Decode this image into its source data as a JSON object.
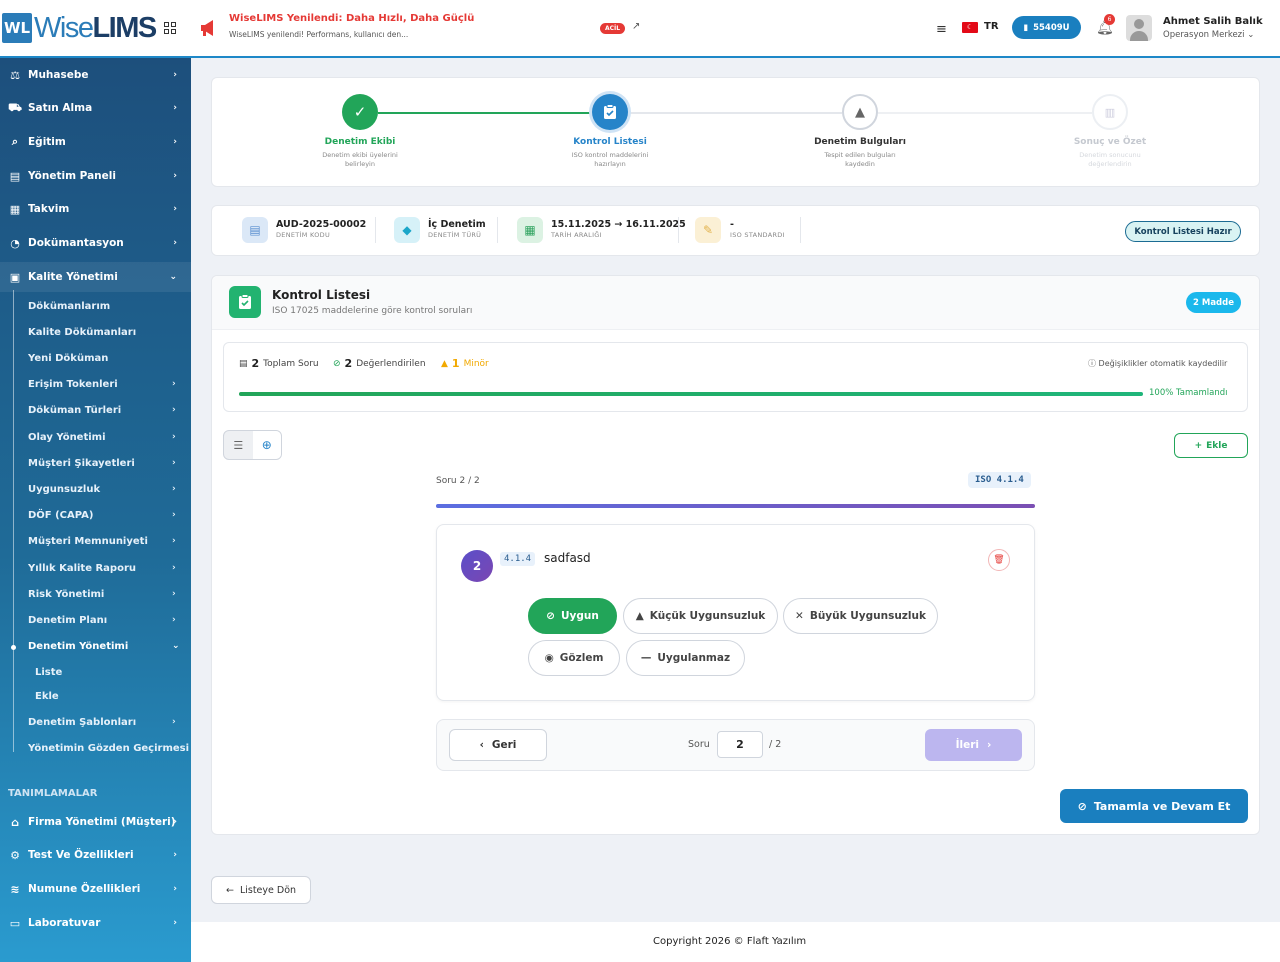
{
  "header": {
    "logo_mark": "WL",
    "logo_text_a": "Wise",
    "logo_text_b": "LIMS",
    "announcement_title": "WiseLIMS Yenilendi: Daha Hızlı, Daha Güçlü",
    "announcement_sub": "WiseLIMS yenilendi! Performans, kullanıcı den...",
    "urgent_badge": "ACİL",
    "flag_icon": "turkey-flag-icon",
    "language": "TR",
    "company_code": "55409U",
    "notification_count": "6",
    "user_name": "Ahmet Salih Balık",
    "user_role": "Operasyon Merkezi"
  },
  "sidebar": {
    "items": [
      {
        "label": "Muhasebe",
        "icon": "scale-icon"
      },
      {
        "label": "Satın Alma",
        "icon": "cart-icon"
      },
      {
        "label": "Eğitim",
        "icon": "search-icon"
      },
      {
        "label": "Yönetim Paneli",
        "icon": "calendar-icon"
      },
      {
        "label": "Takvim",
        "icon": "calendar-icon"
      },
      {
        "label": "Dokümantasyon",
        "icon": "gauge-icon"
      },
      {
        "label": "Kalite Yönetimi",
        "icon": "document-gear-icon"
      }
    ],
    "subitems": [
      "Dökümanlarım",
      "Kalite Dökümanları",
      "Yeni Döküman",
      "Erişim Tokenleri",
      "Döküman Türleri",
      "Olay Yönetimi",
      "Müşteri Şikayetleri",
      "Uygunsuzluk",
      "DÖF (CAPA)",
      "Müşteri Memnuniyeti",
      "Yıllık Kalite Raporu",
      "Risk Yönetimi",
      "Denetim Planı",
      "Denetim Yönetimi",
      "Denetim Şablonları",
      "Yönetimin Gözden Geçirmesi"
    ],
    "subsub": [
      "Liste",
      "Ekle"
    ],
    "section_title": "TANIMLAMALAR",
    "def_items": [
      {
        "label": "Firma Yönetimi (Müşteri)",
        "icon": "building-icon"
      },
      {
        "label": "Test Ve Özellikleri",
        "icon": "gear-icon"
      },
      {
        "label": "Numune Özellikleri",
        "icon": "dna-icon"
      },
      {
        "label": "Laboratuvar",
        "icon": "monitor-icon"
      }
    ]
  },
  "steps": [
    {
      "title": "Denetim Ekibi",
      "sub": "Denetim ekibi üyelerini belirleyin",
      "state": "done"
    },
    {
      "title": "Kontrol Listesi",
      "sub": "ISO kontrol maddelerini hazırlayın",
      "state": "active"
    },
    {
      "title": "Denetim Bulguları",
      "sub": "Tespit edilen bulguları kaydedin",
      "state": "pending"
    },
    {
      "title": "Sonuç ve Özet",
      "sub": "Denetim sonucunu değerlendirin",
      "state": "disabled"
    }
  ],
  "audit_info": {
    "code": "AUD-2025-00002",
    "code_label": "DENETİM KODU",
    "type": "İç Denetim",
    "type_label": "DENETİM TÜRÜ",
    "range": "15.11.2025 → 16.11.2025",
    "range_label": "TARİH ARALIĞI",
    "standard": "-",
    "standard_label": "ISO STANDARDI",
    "status": "Kontrol Listesi Hazır"
  },
  "checklist": {
    "title": "Kontrol Listesi",
    "subtitle": "ISO 17025 maddelerine göre kontrol soruları",
    "count_badge": "2 Madde",
    "total_num": "2",
    "total_label": "Toplam Soru",
    "evaluated_num": "2",
    "evaluated_label": "Değerlendirilen",
    "minor_num": "1",
    "minor_label": "Minör",
    "autosave": "Değişiklikler otomatik kaydedilir",
    "progress": 1.0,
    "progress_label": "100% Tamamlandı",
    "add_label": "Ekle"
  },
  "question": {
    "counter": "Soru 2 / 2",
    "iso_tag": "ISO 4.1.4",
    "number": "2",
    "clause": "4.1.4",
    "text": "sadfasd",
    "options": [
      "Uygun",
      "Küçük Uygunsuzluk",
      "Büyük Uygunsuzluk",
      "Gözlem",
      "Uygulanmaz"
    ],
    "selected": "Uygun"
  },
  "nav": {
    "back": "Geri",
    "label": "Soru",
    "current": "2",
    "total": "/ 2",
    "next": "İleri"
  },
  "actions": {
    "complete": "Tamamla ve Devam Et",
    "back_to_list": "Listeye Dön"
  },
  "footer": {
    "copyright": "Copyright 2026 © Flaft Yazılım"
  },
  "colors": {
    "primary": "#1a7fbf",
    "success": "#22a559",
    "active": "#2684c9",
    "warning": "#f2a900"
  }
}
